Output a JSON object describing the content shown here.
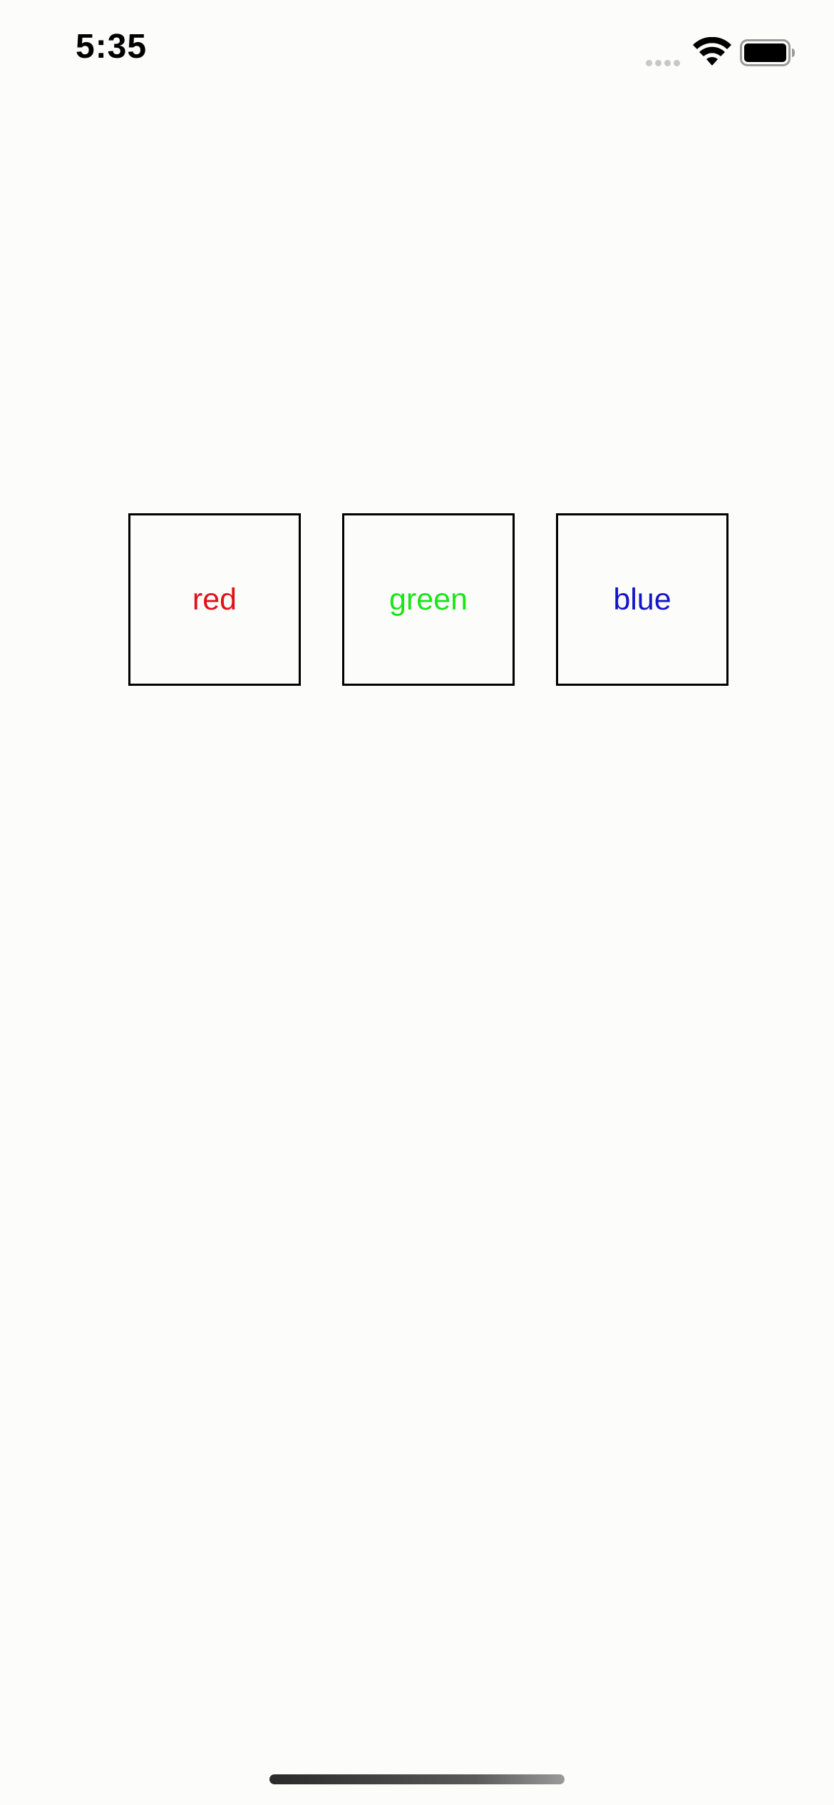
{
  "status_bar": {
    "time": "5:35",
    "signal_icon": "cellular-signal-icon",
    "wifi_icon": "wifi-icon",
    "battery_icon": "battery-icon"
  },
  "boxes": [
    {
      "label": "red",
      "color": "#e0111b"
    },
    {
      "label": "green",
      "color": "#19e617"
    },
    {
      "label": "blue",
      "color": "#1414c8"
    }
  ],
  "home_indicator": "home-indicator"
}
